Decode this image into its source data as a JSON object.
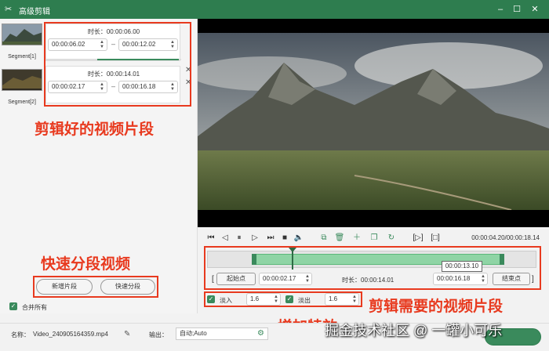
{
  "window": {
    "title": "高级剪辑",
    "app_icon": "scissors-icon"
  },
  "segments": [
    {
      "label": "Segment[1]",
      "duration": "时长：00:00:06.00",
      "start": "00:00:06.02",
      "end": "00:00:12.02"
    },
    {
      "label": "Segment[2]",
      "duration": "时长：00:00:14.01",
      "start": "00:00:02.17",
      "end": "00:00:16.18"
    }
  ],
  "annotations": {
    "clips": "剪辑好的视频片段",
    "quick_split": "快速分段视频",
    "needed_clip": "剪辑需要的视频片段",
    "effects": "增加特效"
  },
  "buttons": {
    "new_segment": "新增片段",
    "quick_split": "快速分段"
  },
  "merge_all": "合并所有",
  "player": {
    "time": "00:00:04.20/00:00:18.14",
    "tooltip": "00:00:13.10"
  },
  "range": {
    "start_btn": "起始点",
    "start_value": "00:00:02.17",
    "duration": "时长：00:00:14.01",
    "end_value": "00:00:16.18",
    "end_btn": "结束点"
  },
  "effects": {
    "fade_in_label": "淡入",
    "fade_in_value": "1.6",
    "fade_out_label": "淡出",
    "fade_out_value": "1.6"
  },
  "output": {
    "name_label": "名称：",
    "name_value": "Video_240905164359.mp4",
    "out_label": "输出：",
    "out_value": "自动;Auto"
  },
  "watermark": "掘金技术社区 @ 一罐小可乐",
  "colors": {
    "titlebar": "#2e7d4f",
    "accent": "#3a8a5c",
    "annotation": "#e83a1f"
  }
}
